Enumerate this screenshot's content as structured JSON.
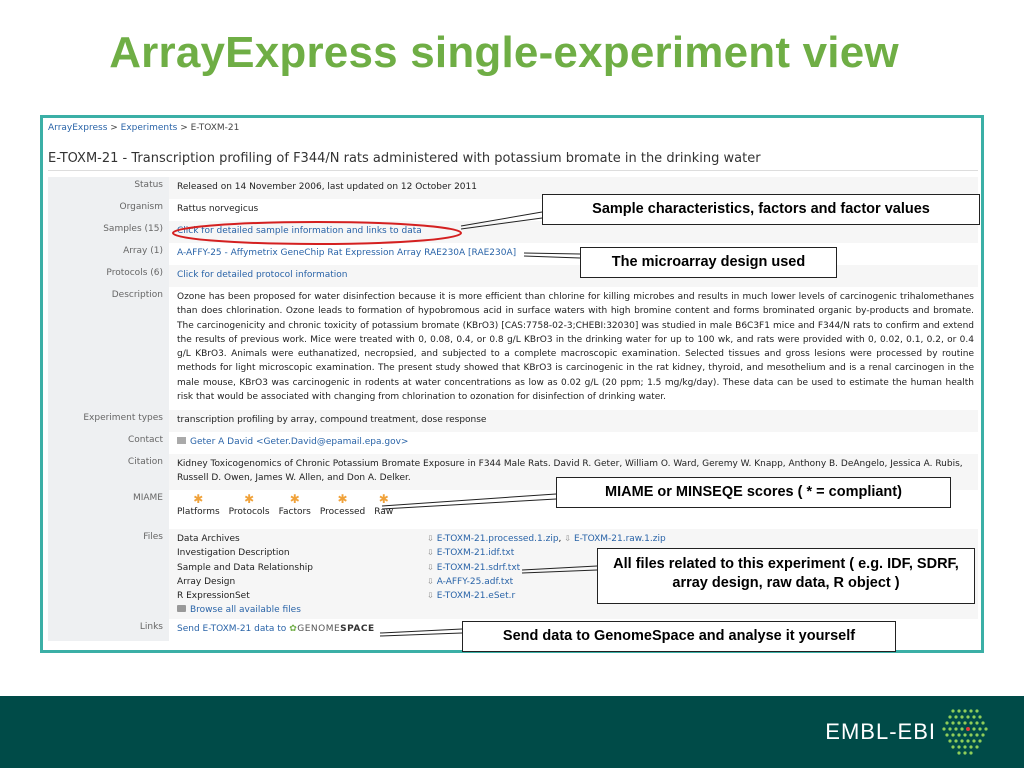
{
  "slide": {
    "title": "ArrayExpress single-experiment view",
    "footer_logo": "EMBL-EBI"
  },
  "breadcrumb": {
    "home": "ArrayExpress",
    "sep1": " > ",
    "experiments": "Experiments",
    "sep2": " > ",
    "current": "E-TOXM-21"
  },
  "experiment": {
    "title": "E-TOXM-21 - Transcription profiling of F344/N rats administered with potassium bromate in the drinking water"
  },
  "labels": {
    "status": "Status",
    "organism": "Organism",
    "samples": "Samples (15)",
    "array": "Array (1)",
    "protocols": "Protocols (6)",
    "description": "Description",
    "experiment_types": "Experiment types",
    "contact": "Contact",
    "citation": "Citation",
    "miame": "MIAME",
    "files": "Files",
    "links": "Links"
  },
  "values": {
    "status": "Released on 14 November 2006, last updated on 12 October 2011",
    "organism": "Rattus norvegicus",
    "samples": "Click for detailed sample information and links to data",
    "array": "A-AFFY-25 - Affymetrix GeneChip Rat Expression Array RAE230A [RAE230A]",
    "protocols": "Click for detailed protocol information",
    "description": "Ozone has been proposed for water disinfection because it is more efficient than chlorine for killing microbes and results in much lower levels of carcinogenic trihalomethanes than does chlorination. Ozone leads to formation of hypobromous acid in surface waters with high bromine content and forms brominated organic by-products and bromate. The carcinogenicity and chronic toxicity of potassium bromate (KBrO3) [CAS:7758-02-3;CHEBI:32030] was studied in male B6C3F1 mice and F344/N rats to confirm and extend the results of previous work. Mice were treated with 0, 0.08, 0.4, or 0.8 g/L KBrO3 in the drinking water for up to 100 wk, and rats were provided with 0, 0.02, 0.1, 0.2, or 0.4 g/L KBrO3. Animals were euthanatized, necropsied, and subjected to a complete macroscopic examination. Selected tissues and gross lesions were processed by routine methods for light microscopic examination. The present study showed that KBrO3 is carcinogenic in the rat kidney, thyroid, and mesothelium and is a renal carcinogen in the male mouse, KBrO3 was carcinogenic in rodents at water concentrations as low as 0.02 g/L (20 ppm; 1.5 mg/kg/day). These data can be used to estimate the human health risk that would be associated with changing from chlorination to ozonation for disinfection of drinking water.",
    "experiment_types": "transcription profiling by array, compound treatment, dose response",
    "contact": "Geter A David <Geter.David@epamail.epa.gov>",
    "citation": "Kidney Toxicogenomics of Chronic Potassium Bromate Exposure in F344 Male Rats. David R. Geter, William O. Ward, Geremy W. Knapp, Anthony B. DeAngelo, Jessica A. Rubis, Russell D. Owen, James W. Allen, and Don A. Delker.",
    "miame": {
      "star": "✱",
      "items": [
        "Platforms",
        "Protocols",
        "Factors",
        "Processed",
        "Raw"
      ]
    },
    "files": {
      "rows": [
        {
          "label": "Data Archives",
          "file1": "E-TOXM-21.processed.1.zip",
          "sep": ", ",
          "file2": "E-TOXM-21.raw.1.zip"
        },
        {
          "label": "Investigation Description",
          "file1": "E-TOXM-21.idf.txt"
        },
        {
          "label": "Sample and Data Relationship",
          "file1": "E-TOXM-21.sdrf.txt"
        },
        {
          "label": "Array Design",
          "file1": "A-AFFY-25.adf.txt"
        },
        {
          "label": "R ExpressionSet",
          "file1": "E-TOXM-21.eSet.r"
        }
      ],
      "browse": "Browse all available files"
    },
    "links": {
      "text": "Send E-TOXM-21 data to",
      "logo_prefix": "GENOME",
      "logo_suffix": "SPACE"
    }
  },
  "callouts": {
    "samples": "Sample characteristics, factors and factor values",
    "array": "The microarray design used",
    "miame": "MIAME or MINSEQE scores ( * = compliant)",
    "files": "All files related to this experiment ( e.g. IDF, SDRF, array design, raw data, R object )",
    "links": "Send data to GenomeSpace and analyse it yourself"
  },
  "colors": {
    "title_green": "#6fae45",
    "frame_teal": "#3bafa6",
    "footer": "#004b48",
    "highlight_ellipse": "#d42020",
    "link_blue": "#2a64a8",
    "star_orange": "#f0a23a"
  }
}
